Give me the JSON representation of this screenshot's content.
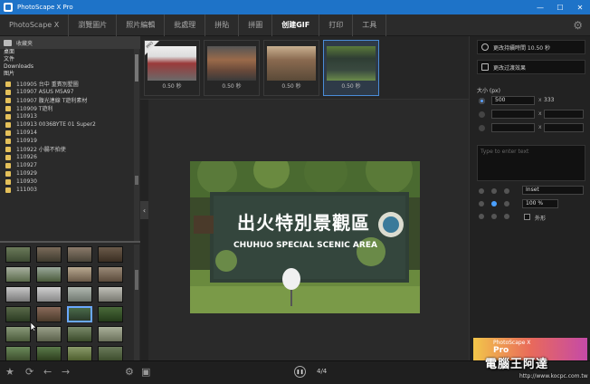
{
  "window": {
    "title": "PhotoScape X Pro",
    "controls": [
      "—",
      "☐",
      "✕"
    ]
  },
  "menu": {
    "items": [
      "PhotoScape X",
      "瀏覽圖片",
      "照片編輯",
      "批處理",
      "拼貼",
      "拼圖",
      "创建GIF",
      "打印",
      "工具"
    ],
    "active_index": 6
  },
  "sidebar": {
    "favorites_label": "收藏夹",
    "shortcuts": [
      "桌面",
      "文件",
      "Downloads",
      "图片"
    ],
    "folders": [
      "110905 台中 重賓別墅圖",
      "110907 ASUS M5A97",
      "110907 腹光連線 T遊利素材",
      "110909 T遊利",
      "110913",
      "110913 0036BYTE 01 Super2",
      "110914",
      "110919",
      "110922 小腸不拍使",
      "110926",
      "110927",
      "110929",
      "110930",
      "111003"
    ]
  },
  "filmstrip": {
    "badge": "PRO",
    "frames": [
      {
        "duration": "0.50 秒"
      },
      {
        "duration": "0.50 秒"
      },
      {
        "duration": "0.50 秒"
      },
      {
        "duration": "0.50 秒"
      }
    ]
  },
  "preview": {
    "sign_chinese": "出火特別景觀區",
    "sign_english": "CHUHUO SPECIAL SCENIC AREA"
  },
  "right_panel": {
    "change_time": "更改持續時間 10.50 秒",
    "change_effect": "更改过渡效果",
    "size_label": "大小 (px)",
    "width_value": "500",
    "height_value": "333",
    "text_placeholder": "Type to enter text",
    "inset_select": "Inset",
    "percent_select": "100 %",
    "outline_label": "外形",
    "ad_line1": "PhotoScape X",
    "ad_line2": "Pro"
  },
  "bottom": {
    "counter": "4/4"
  },
  "watermark": {
    "text": "電腦王阿達",
    "url": "http://www.kocpc.com.tw"
  }
}
